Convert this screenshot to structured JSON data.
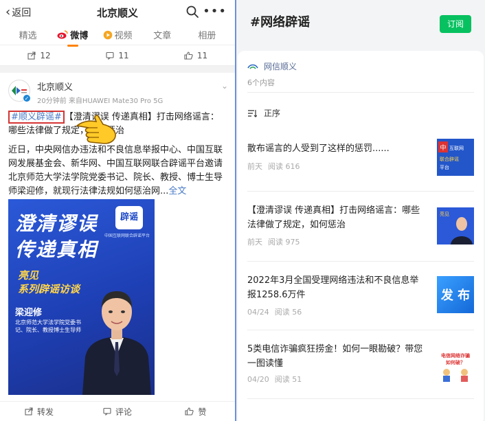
{
  "weibo": {
    "back_label": "返回",
    "title": "北京顺义",
    "tabs": [
      {
        "label": "精选"
      },
      {
        "label": "微博"
      },
      {
        "label": "视频"
      },
      {
        "label": "文章"
      },
      {
        "label": "相册"
      }
    ],
    "stats": {
      "share": "12",
      "comment": "11",
      "like": "11"
    },
    "post": {
      "author": "北京顺义",
      "time": "20分钟前",
      "device": "来自HUAWEI Mate30 Pro 5G",
      "hashtag": "#顺义辟谣#",
      "headline_rest": "【澄清谬误 传递真相】打击网络谣言：哪些法律做了规定，如何惩治",
      "body": "近日，中央网信办违法和不良信息举报中心、中国互联网发展基金会、新华网、中国互联网联合辟谣平台邀请北京师范大学法学院党委书记、院长、教授、博士生导师梁迎修，就现行法律法规如何惩治网...",
      "full_text": "全文",
      "poster": {
        "line1": "澄清谬误",
        "line2": "传递真相",
        "logo": "辟谣",
        "org": "中国互联网联合辟谣平台",
        "series1": "亮见",
        "series2": "系列辟谣访谈",
        "person_name": "梁迎修",
        "person_title": "北京师范大学法学院党委书记、院长、教授博士生导师"
      }
    },
    "actions": {
      "repost": "转发",
      "comment": "评论",
      "like": "赞"
    }
  },
  "topic": {
    "title": "#网络辟谣",
    "subscribe": "订阅",
    "source": "网信顺义",
    "count": "6个内容",
    "order": "正序",
    "articles": [
      {
        "title": "散布谣言的人受到了这样的惩罚......",
        "date": "前天",
        "reads": "阅读 616",
        "thumb_text": "中国互联网联合辟谣平台"
      },
      {
        "title": "【澄清谬误 传递真相】打击网络谣言：哪些法律做了规定，如何惩治",
        "date": "前天",
        "reads": "阅读 975",
        "thumb_text": "亮见"
      },
      {
        "title": "2022年3月全国受理网络违法和不良信息举报1258.6万件",
        "date": "04/24",
        "reads": "阅读 56",
        "thumb_text": "发 布"
      },
      {
        "title": "5类电信诈骗疯狂捞金！如何一眼勘破？带您一图读懂",
        "date": "04/20",
        "reads": "阅读 51",
        "thumb_text": "电信网络诈骗如何破？"
      }
    ]
  },
  "colors": {
    "weibo_accent": "#ff8200",
    "link_blue": "#4a7ac7",
    "wechat_green": "#07c160",
    "highlight_red": "#d43434",
    "poster_blue": "#2b59d8"
  }
}
